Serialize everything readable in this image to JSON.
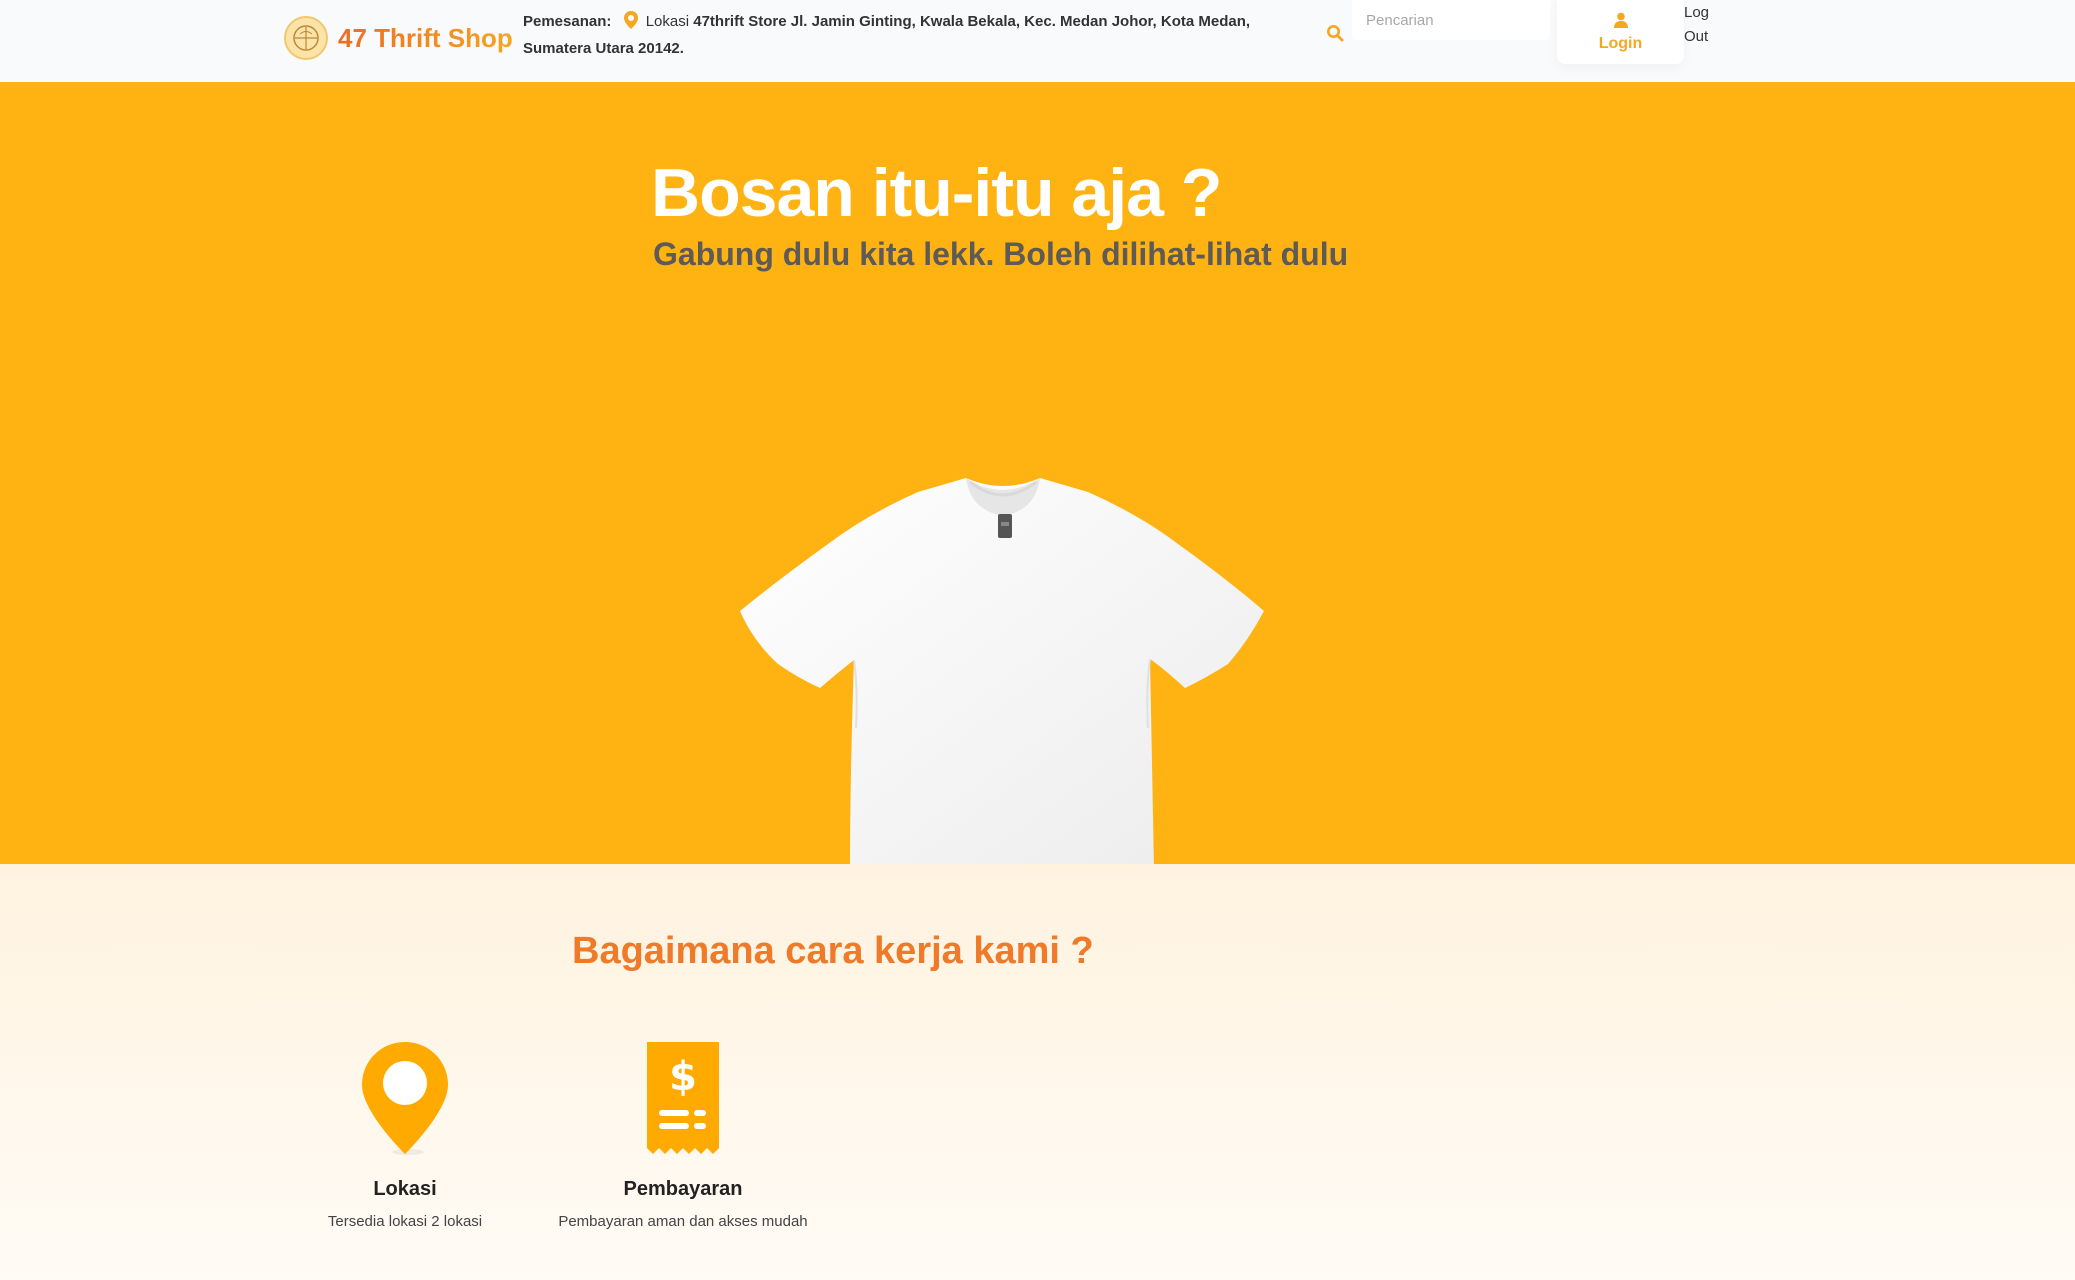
{
  "header": {
    "brand_name": "47 Thrift Shop",
    "logo_icon": "shop-logo-icon",
    "order_label": "Pemesanan:",
    "location_prefix": "Lokasi",
    "location_text": "47thrift Store Jl. Jamin Ginting, Kwala Bekala, Kec. Medan Johor, Kota Medan, Sumatera Utara 20142.",
    "search_placeholder": "Pencarian",
    "login_label": "Login",
    "logout_label": "Log Out"
  },
  "hero": {
    "title": "Bosan itu-itu aja ?",
    "subtitle": "Gabung dulu kita lekk. Boleh dilihat-lihat dulu",
    "image": "white-tshirt"
  },
  "how_it_works": {
    "title": "Bagaimana cara kerja kami ?",
    "features": [
      {
        "icon": "location-pin-icon",
        "title": "Lokasi",
        "desc": "Tersedia lokasi 2 lokasi"
      },
      {
        "icon": "payment-receipt-icon",
        "title": "Pembayaran",
        "desc": "Pembayaran aman dan akses mudah"
      }
    ]
  },
  "colors": {
    "brand_orange": "#ee6b22",
    "accent_yellow": "#f5a623",
    "hero_background": "#ffb312"
  }
}
